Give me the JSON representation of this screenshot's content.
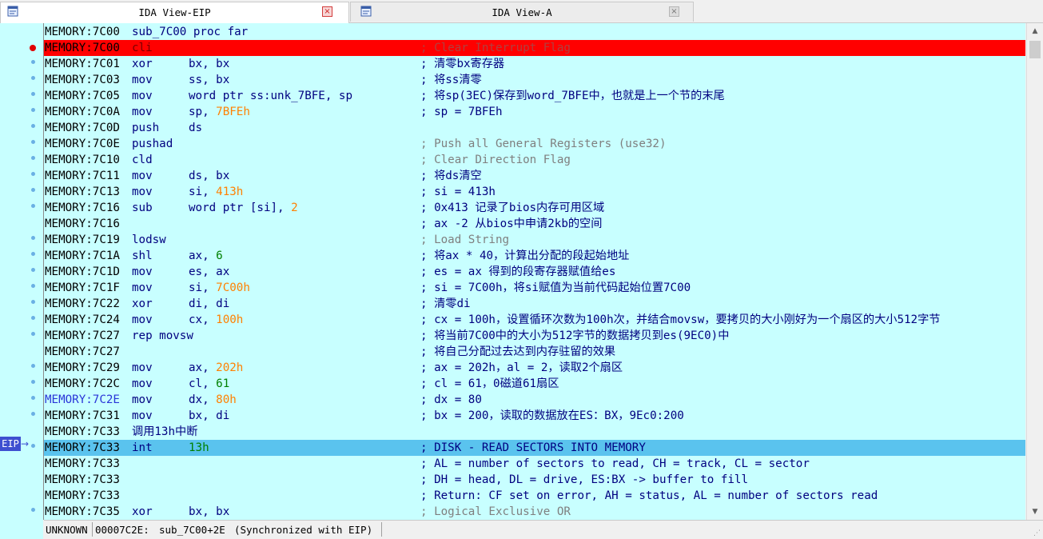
{
  "tabs": [
    {
      "label": "IDA View-EIP",
      "active": true,
      "close": "×"
    },
    {
      "label": "IDA View-A",
      "active": false,
      "close": "×"
    }
  ],
  "eip_marker": "EIP",
  "eip_arrow": "→",
  "rows": [
    {
      "addr": "MEMORY:7C00",
      "inline": "sub_7C00 proc far",
      "dot": false
    },
    {
      "addr": "MEMORY:7C00",
      "mn": "cli",
      "op": "",
      "cmt": "; Clear Interrupt Flag",
      "auto": true,
      "bp": true
    },
    {
      "addr": "MEMORY:7C01",
      "mn": "xor",
      "op": "bx, bx",
      "cmt": "; 清零bx寄存器",
      "dot": true
    },
    {
      "addr": "MEMORY:7C03",
      "mn": "mov",
      "op": "ss, bx",
      "cmt": "; 将ss清零",
      "dot": true
    },
    {
      "addr": "MEMORY:7C05",
      "mn": "mov",
      "op": "word ptr ss:unk_7BFE, sp",
      "cmt": "; 将sp(3EC)保存到word_7BFE中，也就是上一个节的末尾",
      "dot": true
    },
    {
      "addr": "MEMORY:7C0A",
      "mn": "mov",
      "op": "sp, ",
      "num": "7BFEh",
      "numc": "orange",
      "cmt": "; sp = 7BFEh",
      "dot": true
    },
    {
      "addr": "MEMORY:7C0D",
      "mn": "push",
      "op": "ds",
      "cmt": "",
      "dot": true
    },
    {
      "addr": "MEMORY:7C0E",
      "mn": "pushad",
      "op": "",
      "cmt": "; Push all General Registers (use32)",
      "auto": true,
      "dot": true
    },
    {
      "addr": "MEMORY:7C10",
      "mn": "cld",
      "op": "",
      "cmt": "; Clear Direction Flag",
      "auto": true,
      "dot": true
    },
    {
      "addr": "MEMORY:7C11",
      "mn": "mov",
      "op": "ds, bx",
      "cmt": "; 将ds清空",
      "dot": true
    },
    {
      "addr": "MEMORY:7C13",
      "mn": "mov",
      "op": "si, ",
      "num": "413h",
      "numc": "orange",
      "cmt": "; si = 413h",
      "dot": true
    },
    {
      "addr": "MEMORY:7C16",
      "mn": "sub",
      "op": "word ptr [si], ",
      "num": "2",
      "numc": "orange",
      "cmt": "; 0x413 记录了bios内存可用区域",
      "dot": true
    },
    {
      "addr": "MEMORY:7C16",
      "mn": "",
      "op": "",
      "cmt": "; ax -2 从bios中申请2kb的空间",
      "dot": false
    },
    {
      "addr": "MEMORY:7C19",
      "mn": "lodsw",
      "op": "",
      "cmt": "; Load String",
      "auto": true,
      "dot": true
    },
    {
      "addr": "MEMORY:7C1A",
      "mn": "shl",
      "op": "ax, ",
      "num": "6",
      "numc": "green",
      "cmt": "; 将ax * 40，计算出分配的段起始地址",
      "dot": true
    },
    {
      "addr": "MEMORY:7C1D",
      "mn": "mov",
      "op": "es, ax",
      "cmt": "; es = ax 得到的段寄存器赋值给es",
      "dot": true
    },
    {
      "addr": "MEMORY:7C1F",
      "mn": "mov",
      "op": "si, ",
      "num": "7C00h",
      "numc": "orange",
      "cmt": "; si = 7C00h，将si赋值为当前代码起始位置7C00",
      "dot": true
    },
    {
      "addr": "MEMORY:7C22",
      "mn": "xor",
      "op": "di, di",
      "cmt": "; 清零di",
      "dot": true
    },
    {
      "addr": "MEMORY:7C24",
      "mn": "mov",
      "op": "cx, ",
      "num": "100h",
      "numc": "orange",
      "cmt": "; cx = 100h，设置循环次数为100h次，并结合movsw，要拷贝的大小刚好为一个扇区的大小512字节",
      "dot": true
    },
    {
      "addr": "MEMORY:7C27",
      "mn": "rep movsw",
      "op": "",
      "cmt": "; 将当前7C00中的大小为512字节的数据拷贝到es(9EC0)中",
      "dot": true
    },
    {
      "addr": "MEMORY:7C27",
      "mn": "",
      "op": "",
      "cmt": "; 将自己分配过去达到内存驻留的效果",
      "dot": false
    },
    {
      "addr": "MEMORY:7C29",
      "mn": "mov",
      "op": "ax, ",
      "num": "202h",
      "numc": "orange",
      "cmt": "; ax = 202h，al = 2，读取2个扇区",
      "dot": true
    },
    {
      "addr": "MEMORY:7C2C",
      "mn": "mov",
      "op": "cl, ",
      "num": "61",
      "numc": "green",
      "cmt": "; cl = 61，0磁道61扇区",
      "dot": true
    },
    {
      "addr": "MEMORY:7C2E",
      "mn": "mov",
      "op": "dx, ",
      "num": "80h",
      "numc": "orange",
      "cmt": "; dx = 80",
      "dot": true,
      "named": true
    },
    {
      "addr": "MEMORY:7C31",
      "mn": "mov",
      "op": "bx, di",
      "cmt": "; bx = 200，读取的数据放在ES：BX，9Ec0:200",
      "dot": true
    },
    {
      "addr": "MEMORY:7C33",
      "inline": "调用13h中断",
      "dot": false
    },
    {
      "addr": "MEMORY:7C33",
      "mn": "int",
      "op": "",
      "num": "13h",
      "numc": "green",
      "cmt": "; DISK - READ SECTORS INTO MEMORY",
      "eip": true,
      "dot": true
    },
    {
      "addr": "MEMORY:7C33",
      "mn": "",
      "op": "",
      "cmt": "; AL = number of sectors to read, CH = track, CL = sector",
      "dot": false
    },
    {
      "addr": "MEMORY:7C33",
      "mn": "",
      "op": "",
      "cmt": "; DH = head, DL = drive, ES:BX -> buffer to fill",
      "dot": false
    },
    {
      "addr": "MEMORY:7C33",
      "mn": "",
      "op": "",
      "cmt": "; Return: CF set on error, AH = status, AL = number of sectors read",
      "dot": false
    },
    {
      "addr": "MEMORY:7C35",
      "mn": "xor",
      "op": "bx, bx",
      "cmt": "; Logical Exclusive OR",
      "auto": true,
      "dot": true
    }
  ],
  "status": {
    "seg": "UNKNOWN",
    "offset": "00007C2E:",
    "location": "sub_7C00+2E",
    "sync": "(Synchronized with EIP)"
  },
  "icons": {
    "tab": "ida-view-icon",
    "scroll_up": "▲",
    "scroll_down": "▼",
    "grip": "⋰"
  },
  "colors": {
    "listing_bg": "#c8ffff",
    "breakpoint_row": "#ff0000",
    "eip_row": "#5ac3ee",
    "code_text": "#000080",
    "auto_comment": "#7f7f7f",
    "number": "#ff8000",
    "decimal": "#008000"
  }
}
